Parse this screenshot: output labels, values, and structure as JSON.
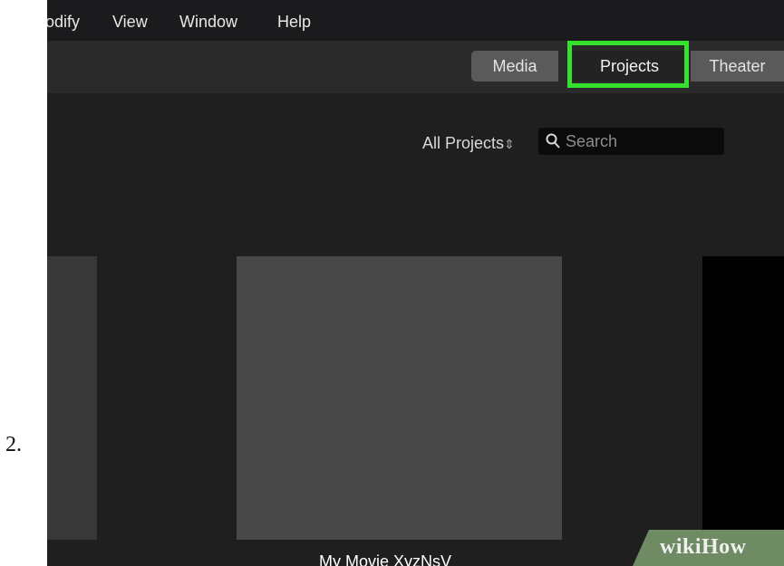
{
  "step": {
    "number": "2."
  },
  "menubar": {
    "items": [
      "odify",
      "View",
      "Window",
      "Help"
    ]
  },
  "toolbar": {
    "tabs": [
      "Media",
      "Projects",
      "Theater"
    ],
    "selected": "Projects"
  },
  "browser": {
    "filter_label": "All Projects",
    "search_placeholder": "Search",
    "project_title": "My Movie XyzNsV"
  },
  "watermark": {
    "text": "wikiHow"
  },
  "colors": {
    "highlight": "#36e02f",
    "background": "#1f1f1f"
  }
}
